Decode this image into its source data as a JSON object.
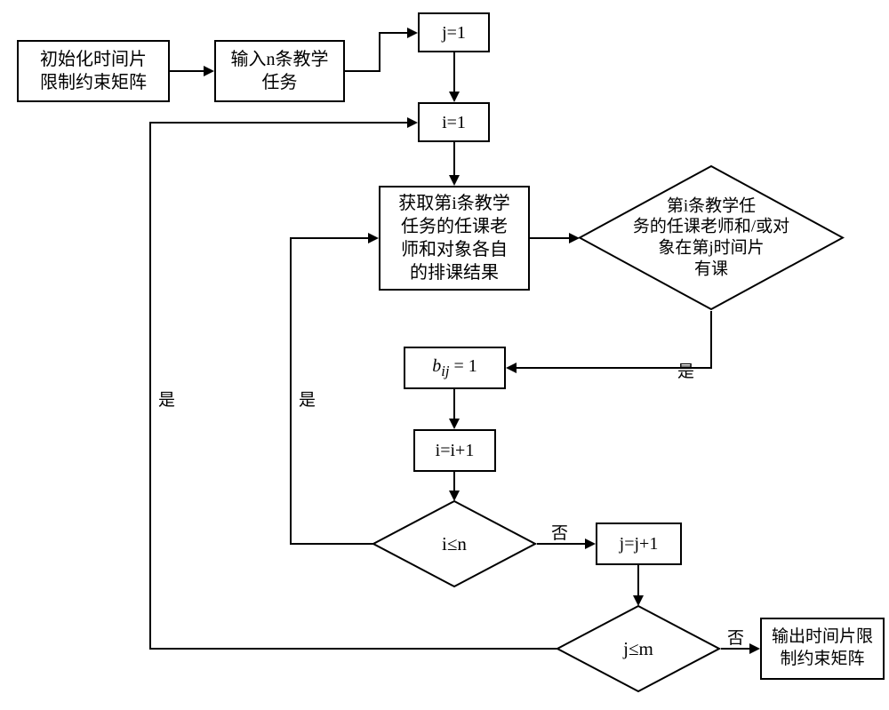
{
  "boxes": {
    "init_matrix": "初始化时间片\n限制约束矩阵",
    "input_tasks": "输入n条教学\n任务",
    "j_eq_1": "j=1",
    "i_eq_1": "i=1",
    "get_results": "获取第i条教学\n任务的任课老\n师和对象各自\n的排课结果",
    "bij_eq_1": "bᵢⱼ = 1",
    "i_inc": "i=i+1",
    "j_inc": "j=j+1",
    "output_matrix": "输出时间片限\n制约束矩阵"
  },
  "diamonds": {
    "check_conflict": "第i条教学任\n务的任课老师和/或对\n象在第j时间片\n有课",
    "i_le_n": "i≤n",
    "j_le_m": "j≤m"
  },
  "labels": {
    "yes": "是",
    "no": "否"
  }
}
